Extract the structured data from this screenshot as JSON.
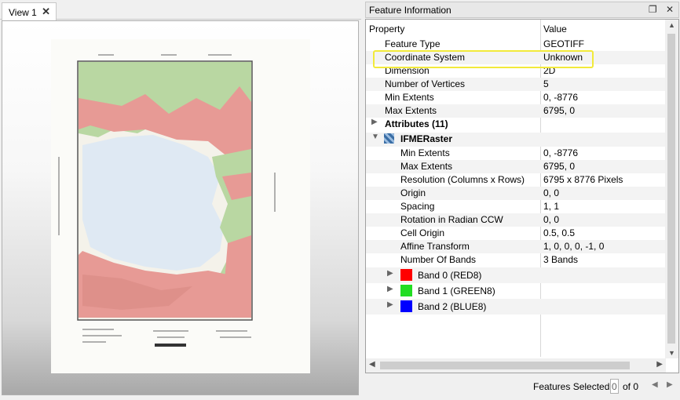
{
  "view": {
    "tab_label": "View 1",
    "close_glyph": "✕"
  },
  "feature_info": {
    "title": "Feature Information",
    "restore_glyph": "❐",
    "close_glyph": "✕",
    "columns": {
      "property": "Property",
      "value": "Value"
    },
    "rows": [
      {
        "property": "Feature Type",
        "value": "GEOTIFF"
      },
      {
        "property": "Coordinate System",
        "value": "Unknown"
      },
      {
        "property": "Dimension",
        "value": "2D"
      },
      {
        "property": "Number of Vertices",
        "value": "5"
      },
      {
        "property": "Min Extents",
        "value": "0, -8776"
      },
      {
        "property": "Max Extents",
        "value": "6795, 0"
      }
    ],
    "attributes_label": "Attributes (11)",
    "raster_label": "IFMERaster",
    "raster_rows": [
      {
        "property": "Min Extents",
        "value": "0, -8776"
      },
      {
        "property": "Max Extents",
        "value": "6795, 0"
      },
      {
        "property": "Resolution (Columns x Rows)",
        "value": "6795 x 8776 Pixels"
      },
      {
        "property": "Origin",
        "value": "0, 0"
      },
      {
        "property": "Spacing",
        "value": "1, 1"
      },
      {
        "property": "Rotation in Radian CCW",
        "value": "0, 0"
      },
      {
        "property": "Cell Origin",
        "value": "0.5, 0.5"
      },
      {
        "property": "Affine Transform",
        "value": "1, 0, 0, 0, -1, 0"
      },
      {
        "property": "Number Of Bands",
        "value": "3 Bands"
      }
    ],
    "bands": [
      {
        "label": "Band 0 (RED8)",
        "color": "#ff0000"
      },
      {
        "label": "Band 1 (GREEN8)",
        "color": "#22dd22"
      },
      {
        "label": "Band 2 (BLUE8)",
        "color": "#0000ff"
      }
    ],
    "highlight_color": "#f2ea3a"
  },
  "status": {
    "features_selected_label": "Features Selected:",
    "selected_value": "0",
    "of_label": "of 0"
  },
  "icons": {
    "expand": "▶",
    "collapse": "▼",
    "prev": "◀",
    "next": "▶",
    "up": "▲",
    "down": "▼"
  }
}
